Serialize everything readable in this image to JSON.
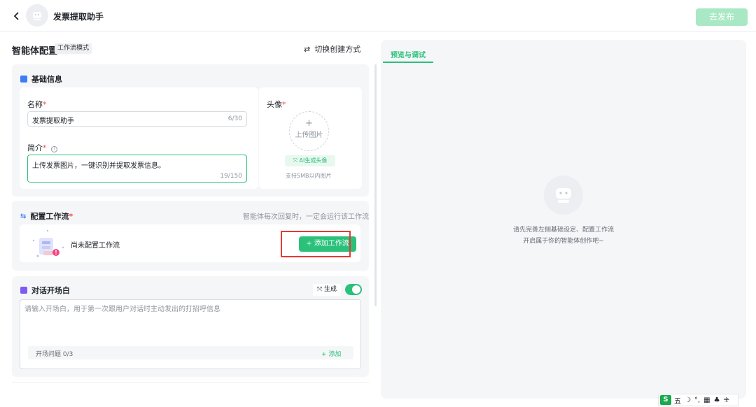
{
  "header": {
    "back_icon": "chevron-left-icon",
    "title": "发票提取助手",
    "publish_label": "去发布"
  },
  "config": {
    "title": "智能体配置",
    "mode_tag": "工作流模式",
    "switch_label": "切换创建方式"
  },
  "basic": {
    "title": "基础信息",
    "name_label": "名称",
    "name_value": "发票提取助手",
    "name_count": "6/30",
    "desc_label": "简介",
    "desc_value": "上传发票图片，一键识别并提取发票信息。",
    "desc_count": "19/150",
    "avatar_label": "头像",
    "upload_plus": "+",
    "upload_label": "上传图片",
    "ai_avatar_label": "AI生成头像",
    "size_hint": "支持5MB以内图片"
  },
  "workflow": {
    "title": "配置工作流",
    "tip": "智能体每次回复时，一定会运行该工作流",
    "empty_text": "尚未配置工作流",
    "add_label": "+ 添加工作流"
  },
  "opener": {
    "title": "对话开场白",
    "generate_label": "生成",
    "toggle_on": true,
    "placeholder": "请输入开场白，用于第一次跟用户对话时主动发出的打招呼信息",
    "questions_label": "开场问题 0/3",
    "add_label": "+ 添加"
  },
  "preview": {
    "tab_label": "预览与调试",
    "empty_line1": "请先完善左侧基础设定、配置工作流",
    "empty_line2": "开启属于你的智能体创作吧~"
  },
  "ime": {
    "logo": "S",
    "mode": "五",
    "items": [
      "☽",
      "°,",
      "▦",
      "♣",
      "⁜"
    ]
  },
  "colors": {
    "accent": "#2bc17b",
    "accent_disabled": "#a8e8c4",
    "highlight": "#e53935",
    "required": "#f54a45"
  }
}
